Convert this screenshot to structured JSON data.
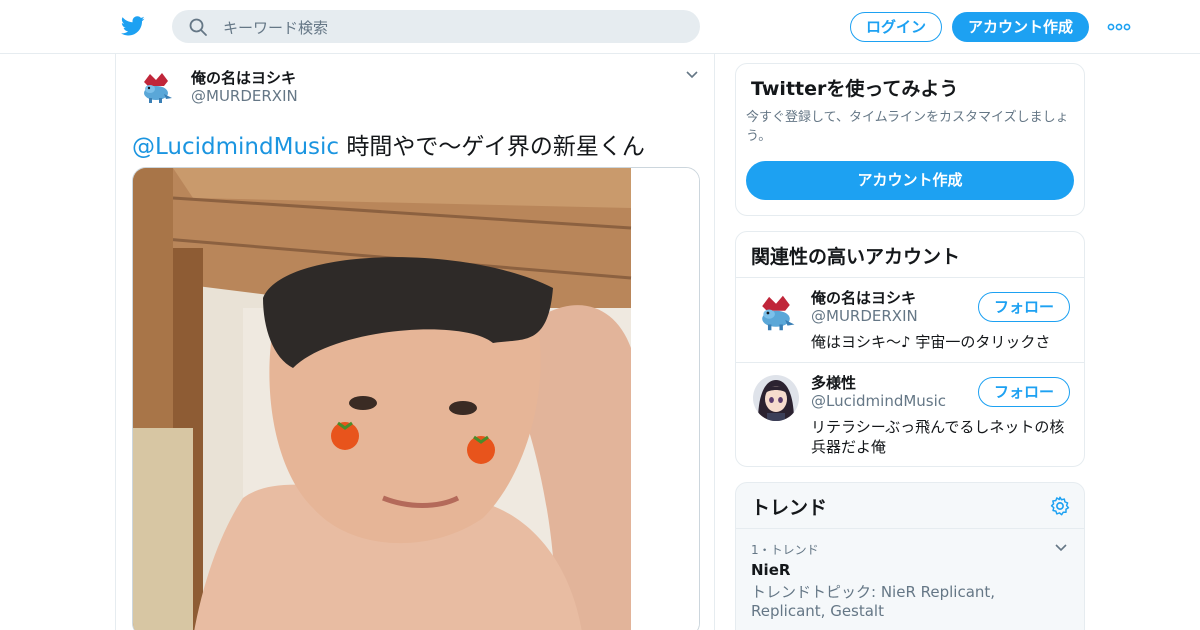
{
  "header": {
    "search_placeholder": "キーワード検索",
    "login_label": "ログイン",
    "signup_label": "アカウント作成",
    "icons": [
      "twitter-bird-icon",
      "search-icon",
      "more-dots-icon"
    ]
  },
  "tweet": {
    "author_name": "俺の名はヨシキ",
    "author_handle": "@MURDERXIN",
    "mention": "@LucidmindMusic",
    "text": " 時間やで～ゲイ界の新星くん"
  },
  "signup_card": {
    "title": "Twitterを使ってみよう",
    "description": "今すぐ登録して、タイムラインをカスタマイズしましょう。",
    "button_label": "アカウント作成"
  },
  "related": {
    "title": "関連性の高いアカウント",
    "accounts": [
      {
        "name": "俺の名はヨシキ",
        "handle": "@MURDERXIN",
        "bio": "俺はヨシキ～♪ 宇宙一のタリックさ",
        "follow_label": "フォロー"
      },
      {
        "name": "多様性",
        "handle": "@LucidmindMusic",
        "bio": "リテラシーぶっ飛んでるしネットの核兵器だよ俺",
        "follow_label": "フォロー"
      }
    ]
  },
  "trends": {
    "title": "トレンド",
    "items": [
      {
        "meta": "1・トレンド",
        "topic": "NieR",
        "description": "トレンドトピック: NieR Replicant, Replicant, Gestalt"
      }
    ]
  },
  "colors": {
    "accent": "#1da1f2",
    "mention": "#1b95e0",
    "muted_text": "#657786",
    "border": "#e6ecf0"
  }
}
